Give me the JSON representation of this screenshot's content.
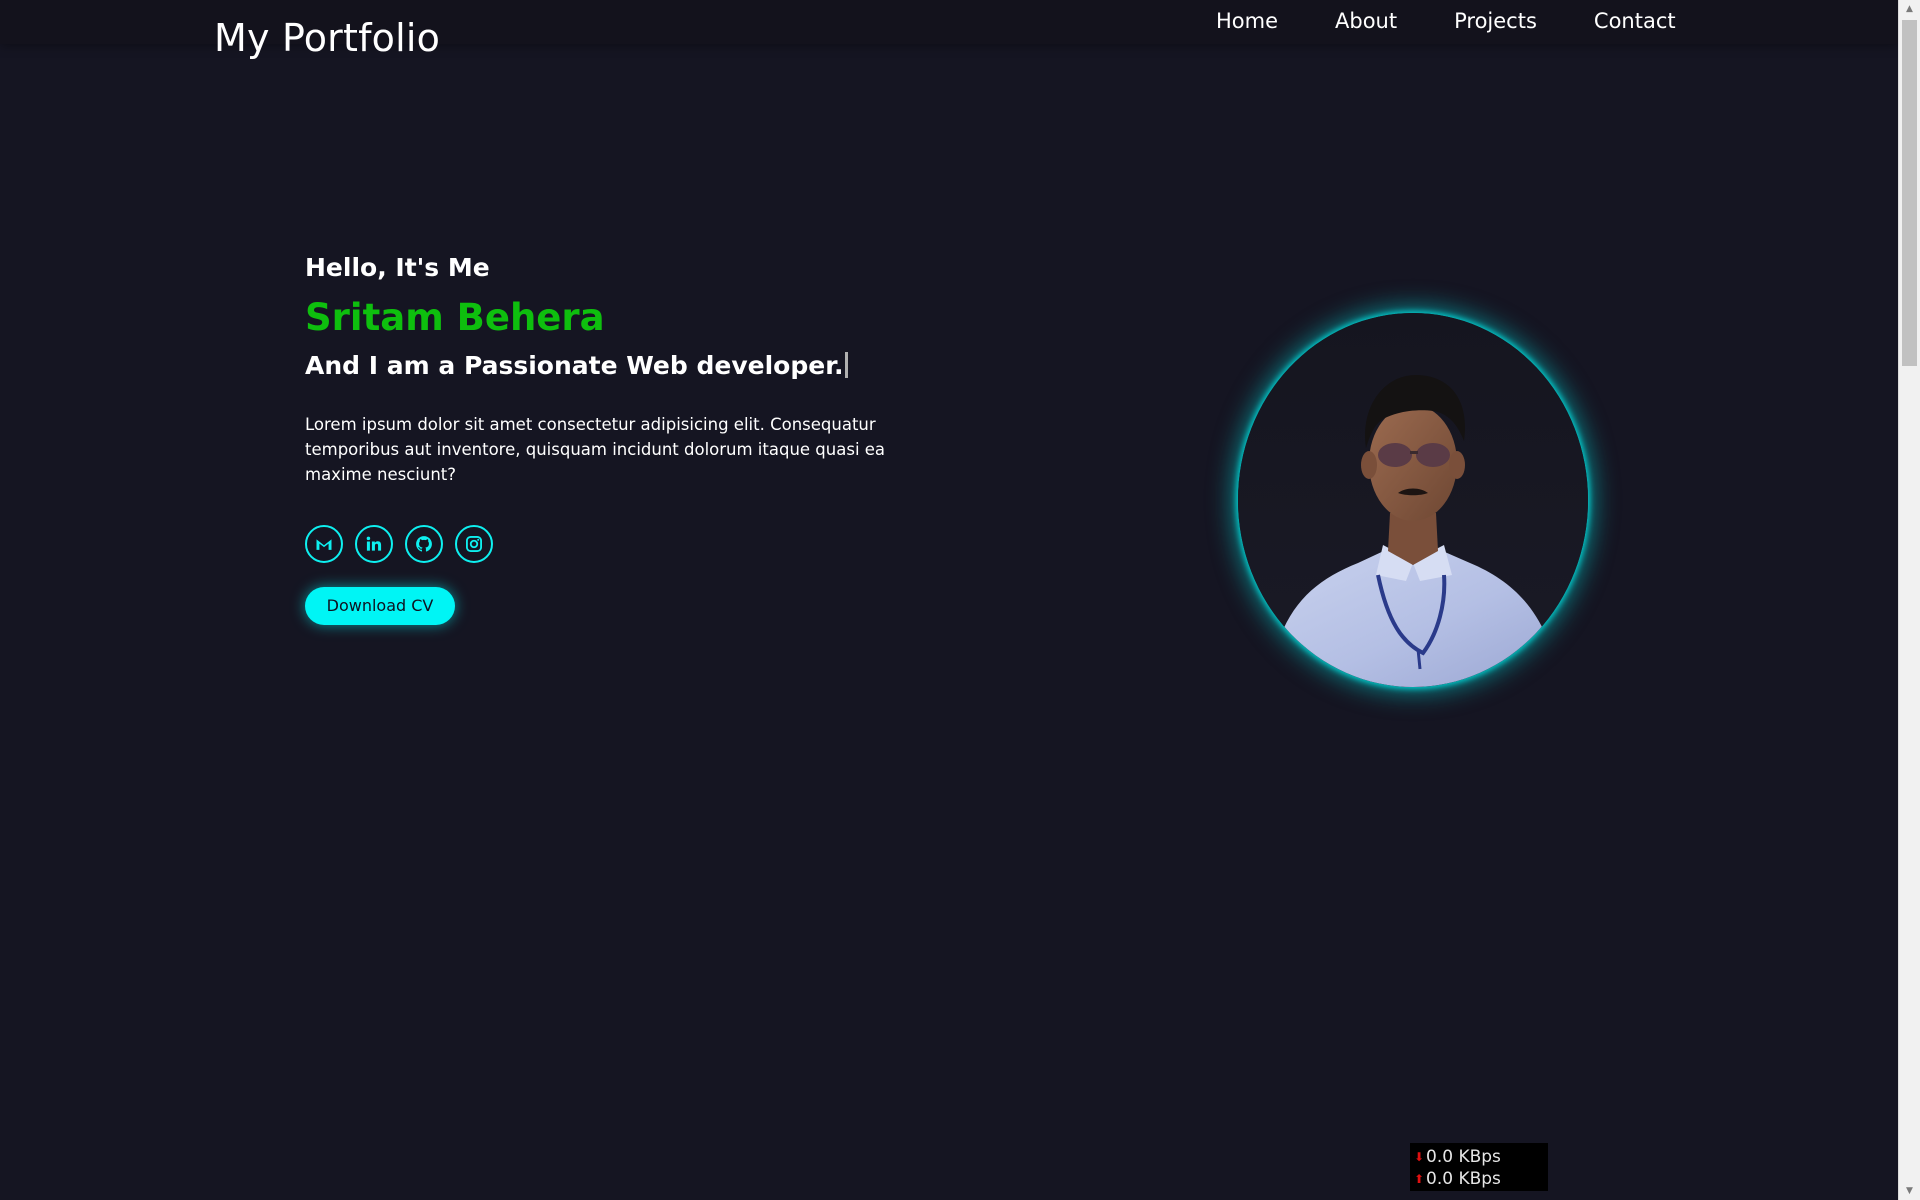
{
  "header": {
    "logo": "My Portfolio",
    "nav": [
      {
        "label": "Home"
      },
      {
        "label": "About"
      },
      {
        "label": "Projects"
      },
      {
        "label": "Contact"
      }
    ]
  },
  "hero": {
    "greeting": "Hello, It's Me",
    "name": "Sritam Behera",
    "role": "And I am a Passionate Web developer.",
    "description": "Lorem ipsum dolor sit amet consectetur adipisicing elit. Consequatur temporibus aut inventore, quisquam incidunt dolorum itaque quasi ea maxime nesciunt?",
    "socials": [
      {
        "icon": "gmail-icon"
      },
      {
        "icon": "linkedin-icon"
      },
      {
        "icon": "github-icon"
      },
      {
        "icon": "instagram-icon"
      }
    ],
    "cv_button": "Download CV",
    "profile_image": "profile-photo"
  },
  "netspeed": {
    "download": "0.0 KBps",
    "upload": "0.0 KBps"
  },
  "colors": {
    "background": "#151522",
    "accent": "#00f5f5",
    "name": "#0ebf0e"
  }
}
